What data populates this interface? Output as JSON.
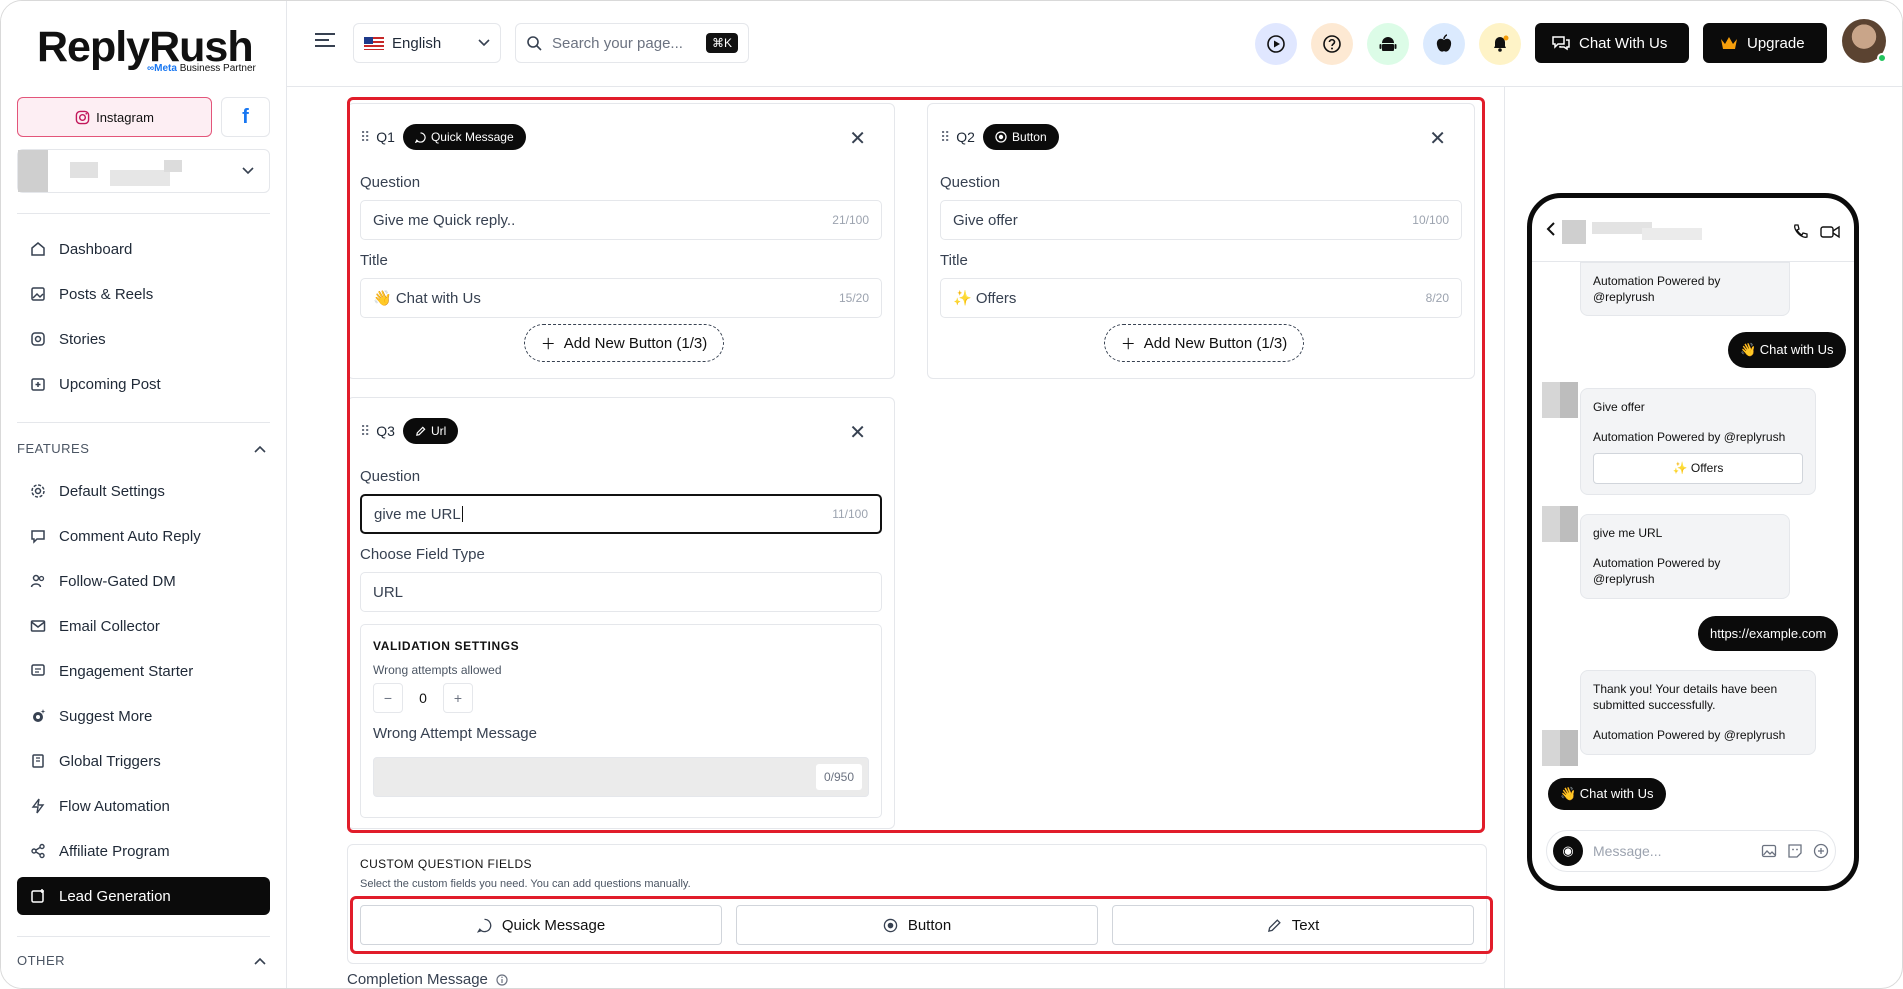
{
  "brand": {
    "name": "ReplyRush",
    "sub_meta": "∞Meta",
    "sub_text": "Business Partner"
  },
  "sidebar": {
    "platform_instagram": "Instagram",
    "platform_facebook": "f",
    "nav": [
      {
        "label": "Dashboard",
        "icon": "home-icon"
      },
      {
        "label": "Posts & Reels",
        "icon": "image-icon"
      },
      {
        "label": "Stories",
        "icon": "stories-icon"
      },
      {
        "label": "Upcoming Post",
        "icon": "calendar-plus-icon"
      }
    ],
    "features_heading": "FEATURES",
    "features": [
      {
        "label": "Default Settings",
        "icon": "gear-icon"
      },
      {
        "label": "Comment Auto Reply",
        "icon": "comment-icon"
      },
      {
        "label": "Follow-Gated DM",
        "icon": "users-icon"
      },
      {
        "label": "Email Collector",
        "icon": "mail-icon"
      },
      {
        "label": "Engagement Starter",
        "icon": "message-lines-icon"
      },
      {
        "label": "Suggest More",
        "icon": "sparkle-gear-icon"
      },
      {
        "label": "Global Triggers",
        "icon": "book-icon"
      },
      {
        "label": "Flow Automation",
        "icon": "bolt-icon"
      },
      {
        "label": "Affiliate Program",
        "icon": "share-icon"
      },
      {
        "label": "Lead Generation",
        "icon": "lead-icon",
        "active": true
      }
    ],
    "other_heading": "OTHER"
  },
  "header": {
    "language": "English",
    "search_placeholder": "Search your page...",
    "search_shortcut": "⌘K",
    "chat_button": "Chat With Us",
    "upgrade_button": "Upgrade"
  },
  "questions": [
    {
      "num": "Q1",
      "type": "Quick Message",
      "question_label": "Question",
      "question": "Give me Quick reply..",
      "question_count": "21/100",
      "title_label": "Title",
      "title": "👋 Chat with Us",
      "title_count": "15/20",
      "add_button": "Add New Button (1/3)"
    },
    {
      "num": "Q2",
      "type": "Button",
      "question_label": "Question",
      "question": "Give offer",
      "question_count": "10/100",
      "title_label": "Title",
      "title": "✨ Offers",
      "title_count": "8/20",
      "add_button": "Add New Button (1/3)"
    },
    {
      "num": "Q3",
      "type": "Url",
      "question_label": "Question",
      "question": "give me URL",
      "question_count": "11/100",
      "field_type_label": "Choose Field Type",
      "field_type": "URL",
      "validation_heading": "VALIDATION SETTINGS",
      "wrong_attempts_label": "Wrong attempts allowed",
      "wrong_attempts_value": "0",
      "wrong_message_label": "Wrong Attempt Message",
      "wrong_message_count": "0/950"
    }
  ],
  "custom_fields": {
    "heading": "CUSTOM QUESTION FIELDS",
    "description": "Select the custom fields you need. You can add questions manually.",
    "buttons": [
      "Quick Message",
      "Button",
      "Text"
    ]
  },
  "completion_label": "Completion Message",
  "preview": {
    "msg_powered_1a": "Automation Powered by",
    "msg_powered_1b": "@replyrush",
    "out_chat": "👋 Chat with Us",
    "offer_q": "Give offer",
    "offer_powered": "Automation Powered by @replyrush",
    "offer_btn": "✨ Offers",
    "url_q": "give me URL",
    "url_powered_a": "Automation Powered by",
    "url_powered_b": "@replyrush",
    "out_url": "https://example.com",
    "thanks": "Thank you! Your details have been submitted successfully.",
    "thanks_powered": "Automation Powered by @replyrush",
    "quick_chip": "👋 Chat with Us",
    "message_placeholder": "Message..."
  }
}
